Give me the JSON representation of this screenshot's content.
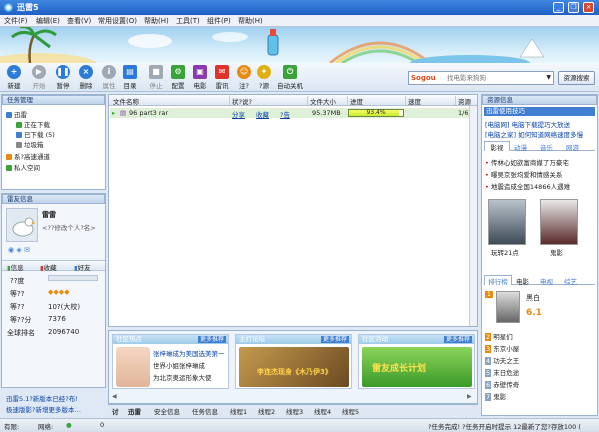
{
  "window": {
    "title": "迅雷5",
    "minimize": "_",
    "restore": "❐",
    "close": "×"
  },
  "menu": [
    "文件(F)",
    "编辑(E)",
    "查看(V)",
    "常用设置(O)",
    "帮助(H)",
    "工具(T)",
    "组件(P)",
    "帮助(H)"
  ],
  "toolbar": {
    "buttons": [
      {
        "label": "新建",
        "icon": "new-icon",
        "color": "#2c7bd6"
      },
      {
        "label": "开始",
        "icon": "play-icon",
        "color": "#a0a8b4",
        "disabled": true
      },
      {
        "label": "暂停",
        "icon": "pause-icon",
        "color": "#2c7bd6"
      },
      {
        "label": "删除",
        "icon": "delete-icon",
        "color": "#2c7bd6"
      },
      {
        "label": "属性",
        "icon": "properties-icon",
        "color": "#a0a8b4",
        "disabled": true
      },
      {
        "label": "目录",
        "icon": "folder-icon",
        "color": "#2c7bd6"
      },
      {
        "label": "停止",
        "icon": "stop-icon",
        "color": "#a0a8b4",
        "disabled": true
      },
      {
        "label": "配置",
        "icon": "config-icon",
        "color": "#3aa43a"
      },
      {
        "label": "电影",
        "icon": "movie-icon",
        "color": "#8a3bb0"
      },
      {
        "label": "雷讯",
        "icon": "im-icon",
        "color": "#e0332b"
      },
      {
        "label": "注?",
        "icon": "register-icon",
        "color": "#e88a12"
      },
      {
        "label": "?源",
        "icon": "source-icon",
        "color": "#e0b012"
      },
      {
        "label": "自动关机",
        "icon": "shutdown-icon",
        "color": "#3aa43a"
      }
    ]
  },
  "search": {
    "engine": "Sogou",
    "placeholder": "找电影来狗狗",
    "button": "资源搜索"
  },
  "tasks": {
    "title": "任务管理",
    "items": [
      {
        "label": "迅雷",
        "color": "#3f7ed0"
      },
      {
        "label": "正在下载",
        "color": "#3aa43a"
      },
      {
        "label": "已下载 (5)",
        "color": "#3f7ed0"
      },
      {
        "label": "垃圾箱",
        "color": "#888"
      },
      {
        "label": "系?高速通道",
        "color": "#e88a12"
      },
      {
        "label": "私人空间",
        "color": "#3aa43a"
      }
    ]
  },
  "user": {
    "title": "雷友信息",
    "name": "雷雷",
    "signature": "<??修改个人?名>",
    "tabs": [
      "信息",
      "收藏",
      "好友"
    ],
    "fields": [
      {
        "k": "??度",
        "v": ""
      },
      {
        "k": "等??",
        "v": ""
      },
      {
        "k": "等??",
        "v": "10?(大校)"
      },
      {
        "k": "等??分",
        "v": "7376"
      },
      {
        "k": "全球排名",
        "v": "2096740"
      }
    ],
    "links": [
      "迅雷5.1?新版本已经?布!",
      "极速版影?新增更多版本…"
    ]
  },
  "files": {
    "columns": [
      "文件名称",
      "状?说?",
      "文件大小",
      "进度",
      "速度",
      "资源"
    ],
    "rows": [
      {
        "name": "96 part3 rar",
        "status": [
          "分享",
          "收藏",
          "?告"
        ],
        "size": "95.37MB",
        "progress": 0.93,
        "progress_label": "93.4%",
        "speed": "",
        "resources": "1/6"
      }
    ]
  },
  "community": {
    "columns": [
      {
        "title": "社区热点",
        "more": "更多推荐",
        "text": [
          "张梓琳成为美国选美第一",
          "世界小姐张梓琳成",
          "为北京奥运形象大使"
        ]
      },
      {
        "title": "主打论坛",
        "more": "更多推荐",
        "text": [
          "李连杰现身《木乃伊3》"
        ]
      },
      {
        "title": "社区活动",
        "more": "更多推荐",
        "text": [
          "雷友成长计划"
        ]
      }
    ]
  },
  "tabs": [
    "讨",
    "迅雷",
    "安全信息",
    "任务信息",
    "线程1",
    "线程2",
    "线程3",
    "线程4",
    "线程5"
  ],
  "resources": {
    "title": "资源信息",
    "subtitle": "迅雷使用技巧",
    "news": [
      "[电脑网] 电脑下载提巧大放送",
      "[电脑之家] 如何知道网络速度多慢"
    ],
    "tabs": [
      "影视",
      "动漫",
      "音乐",
      "网游"
    ],
    "headlines": [
      "传林心如欲富商媒了万豪宅",
      "曝吴京张均爱和情感关系",
      "地震造成全国14866人遇难"
    ],
    "posters": [
      {
        "caption": "玩转21点"
      },
      {
        "caption": "鬼影"
      }
    ],
    "rank_tabs": [
      "排行榜",
      "电影",
      "电视",
      "综艺"
    ],
    "rank_top": {
      "title": "黑白",
      "score": "6.1"
    },
    "rank_list": [
      {
        "n": "2",
        "t": "明星们"
      },
      {
        "n": "3",
        "t": "东京小屋"
      },
      {
        "n": "4",
        "t": "功夫之王"
      },
      {
        "n": "5",
        "t": "末日危途"
      },
      {
        "n": "6",
        "t": "赤壁传奇"
      },
      {
        "n": "7",
        "t": "鬼影"
      }
    ]
  },
  "status": {
    "left": "有限:",
    "net_label": "网络:",
    "center": "0",
    "right": "?任务完成!  ?任务开启时提示 12最新了您?存放100 ("
  }
}
